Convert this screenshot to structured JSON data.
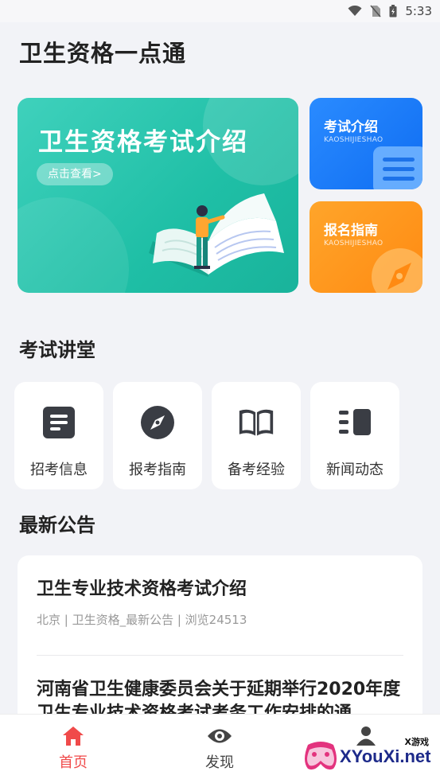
{
  "status_bar": {
    "time": "5:33"
  },
  "app": {
    "title": "卫生资格一点通"
  },
  "banner": {
    "title": "卫生资格考试介绍",
    "button": "点击查看>"
  },
  "cards": [
    {
      "title": "考试介绍",
      "subtitle": "KAOSHIJIESHAO",
      "color": "#1677ff"
    },
    {
      "title": "报名指南",
      "subtitle": "KAOSHIJIESHAO",
      "color": "#ff9518"
    }
  ],
  "sections": {
    "lecture": "考试讲堂",
    "notice": "最新公告"
  },
  "tiles": [
    {
      "label": "招考信息",
      "icon": "document-icon"
    },
    {
      "label": "报考指南",
      "icon": "compass-icon"
    },
    {
      "label": "备考经验",
      "icon": "book-icon"
    },
    {
      "label": "新闻动态",
      "icon": "news-icon"
    }
  ],
  "news": [
    {
      "title": "卫生专业技术资格考试介绍",
      "meta": "北京 | 卫生资格_最新公告 | 浏览24513"
    },
    {
      "title": "河南省卫生健康委员会关于延期举行2020年度卫生专业技术资格考试考务工作安排的通"
    }
  ],
  "tabbar": [
    {
      "label": "首页",
      "icon": "home-icon",
      "active": true
    },
    {
      "label": "发现",
      "icon": "eye-icon",
      "active": false
    },
    {
      "label": "",
      "icon": "user-icon",
      "active": false
    }
  ],
  "watermark": {
    "text": "XYouXi.net",
    "small": "X游戏"
  },
  "colors": {
    "accent": "#f04a4a",
    "teal": "#1fbfa6"
  }
}
